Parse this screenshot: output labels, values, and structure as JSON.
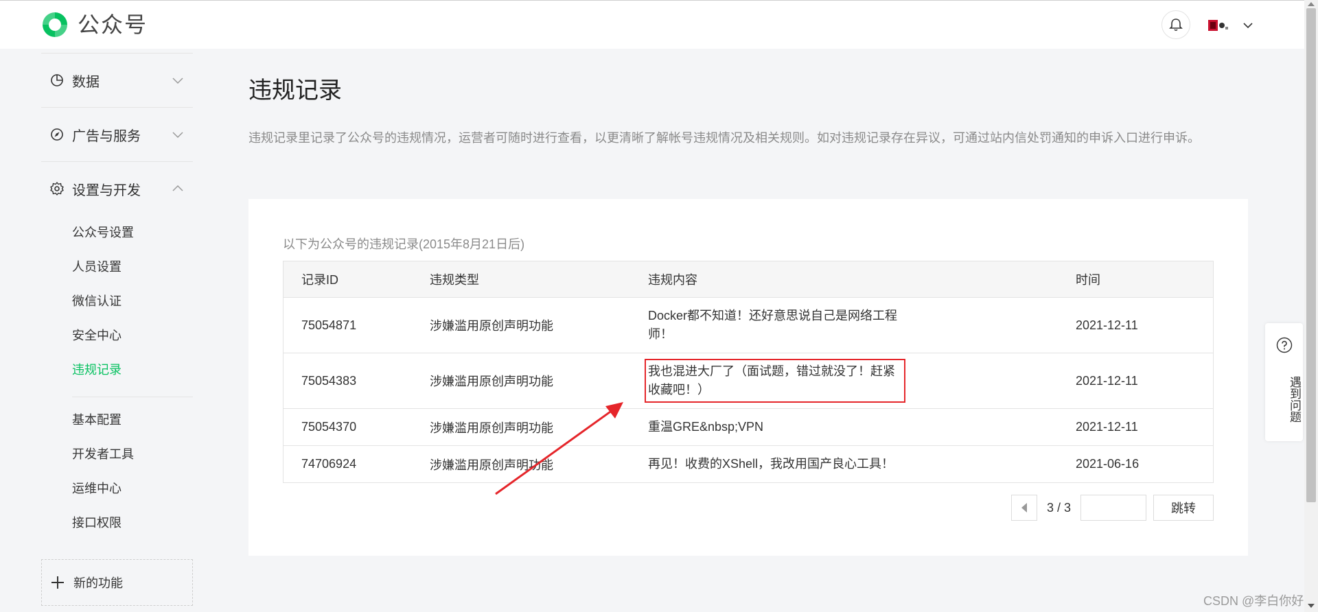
{
  "header": {
    "brand": "公众号"
  },
  "sidebar": {
    "groups": [
      {
        "label": "数据",
        "icon": "pie-chart-icon",
        "expanded": false
      },
      {
        "label": "广告与服务",
        "icon": "compass-icon",
        "expanded": false
      },
      {
        "label": "设置与开发",
        "icon": "gear-icon",
        "expanded": true
      }
    ],
    "sub_items_a": [
      "公众号设置",
      "人员设置",
      "微信认证",
      "安全中心",
      "违规记录"
    ],
    "sub_items_b": [
      "基本配置",
      "开发者工具",
      "运维中心",
      "接口权限"
    ],
    "active_item": "违规记录",
    "new_feature_label": "新的功能"
  },
  "main": {
    "title": "违规记录",
    "description": "违规记录里记录了公众号的违规情况，运营者可随时进行查看，以更清晰了解帐号违规情况及相关规则。如对违规记录存在异议，可通过站内信处罚通知的申诉入口进行申诉。",
    "table_caption": "以下为公众号的违规记录(2015年8月21日后)",
    "columns": [
      "记录ID",
      "违规类型",
      "违规内容",
      "时间"
    ],
    "rows": [
      {
        "id": "75054871",
        "type": "涉嫌滥用原创声明功能",
        "content": "Docker都不知道！还好意思说自己是网络工程师！",
        "time": "2021-12-11"
      },
      {
        "id": "75054383",
        "type": "涉嫌滥用原创声明功能",
        "content": "我也混进大厂了（面试题，错过就没了！赶紧收藏吧！）",
        "time": "2021-12-11"
      },
      {
        "id": "75054370",
        "type": "涉嫌滥用原创声明功能",
        "content": "重温GRE&nbsp;VPN",
        "time": "2021-12-11"
      },
      {
        "id": "74706924",
        "type": "涉嫌滥用原创声明功能",
        "content": "再见！收费的XShell，我改用国产良心工具！",
        "time": "2021-06-16"
      }
    ],
    "pagination": {
      "current": "3 / 3",
      "jump_label": "跳转",
      "input_value": ""
    }
  },
  "help": {
    "label": "遇到问题"
  },
  "watermark": "CSDN @李白你好",
  "colors": {
    "brand_green": "#07c160",
    "link_blue": "#576b95",
    "annotation_red": "#e5252a"
  }
}
